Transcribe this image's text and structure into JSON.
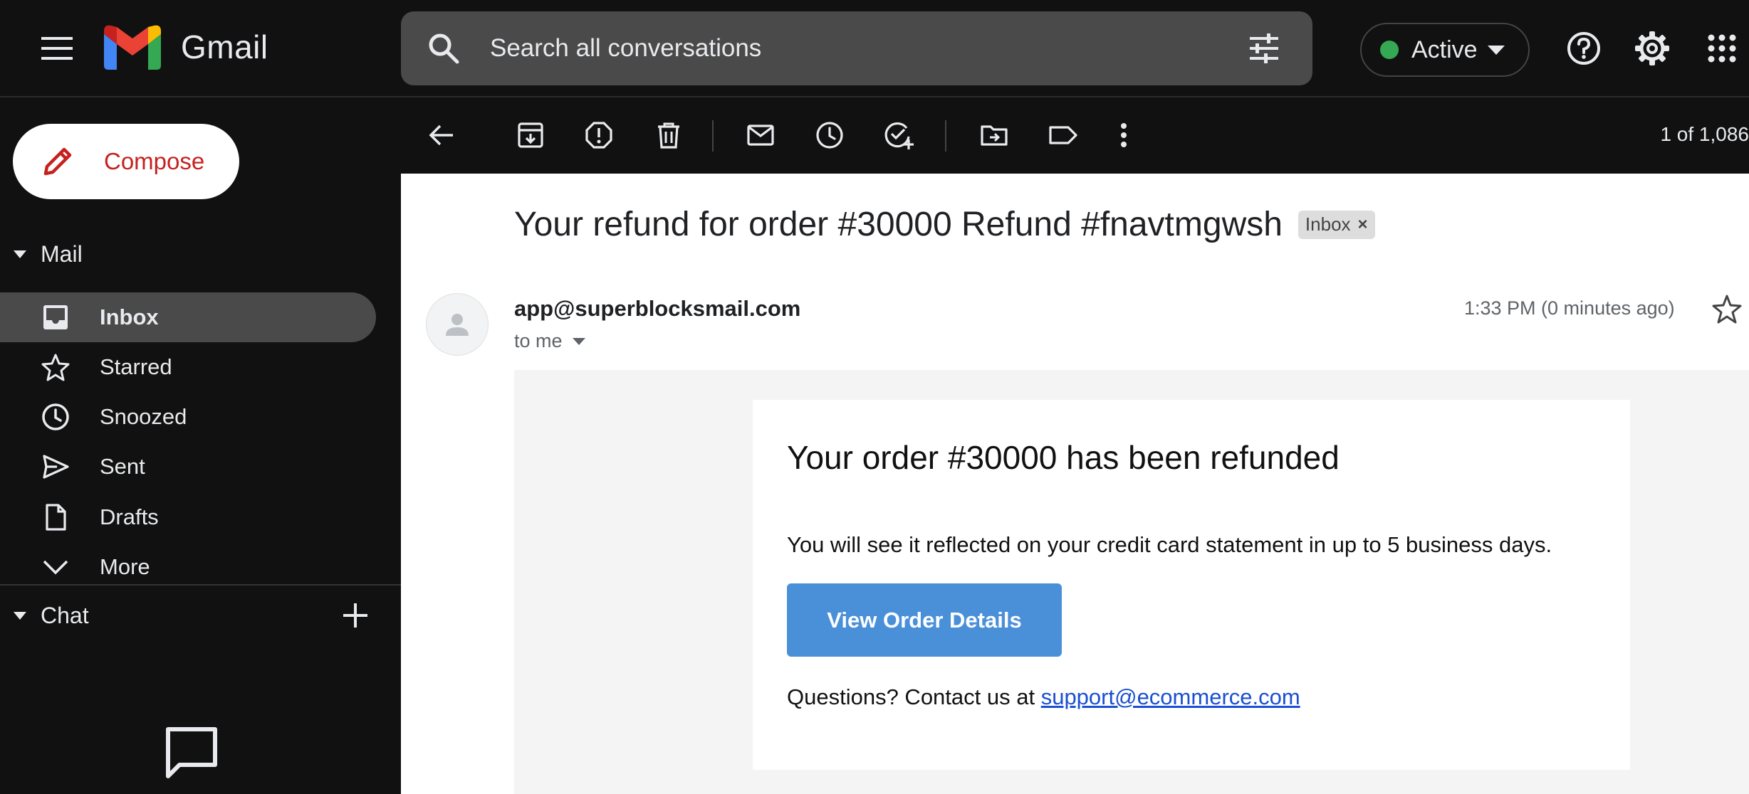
{
  "header": {
    "app_name": "Gmail",
    "search_placeholder": "Search all conversations",
    "status_label": "Active",
    "status_color": "#34a853",
    "icons": [
      "menu-icon",
      "gmail-logo",
      "search-icon",
      "tune-icon",
      "help-icon",
      "gear-icon",
      "apps-icon"
    ]
  },
  "sidebar": {
    "compose_label": "Compose",
    "mail_section_label": "Mail",
    "items": [
      {
        "label": "Inbox",
        "icon": "inbox-icon",
        "active": true
      },
      {
        "label": "Starred",
        "icon": "star-icon",
        "active": false
      },
      {
        "label": "Snoozed",
        "icon": "clock-icon",
        "active": false
      },
      {
        "label": "Sent",
        "icon": "send-icon",
        "active": false
      },
      {
        "label": "Drafts",
        "icon": "draft-icon",
        "active": false
      },
      {
        "label": "More",
        "icon": "chevron-down-icon",
        "active": false
      }
    ],
    "chat_section_label": "Chat"
  },
  "toolbar": {
    "pager": "1 of 1,086",
    "icons": [
      "back-arrow-icon",
      "archive-icon",
      "report-spam-icon",
      "delete-icon",
      "mark-unread-icon",
      "snooze-icon",
      "add-task-icon",
      "move-to-icon",
      "label-icon",
      "more-vert-icon"
    ]
  },
  "message": {
    "subject": "Your refund for order #30000 Refund #fnavtmgwsh",
    "label_chip": "Inbox",
    "label_chip_close": "×",
    "sender": "app@superblocksmail.com",
    "to": "to me",
    "time": "1:33 PM (0 minutes ago)"
  },
  "email_body": {
    "heading": "Your order #30000 has been refunded",
    "paragraph": "You will see it reflected on your credit card statement in up to 5 business days.",
    "button_label": "View Order Details",
    "button_color": "#4a90d9",
    "questions_text": "Questions? Contact us at ",
    "support_link": "support@ecommerce.com"
  }
}
